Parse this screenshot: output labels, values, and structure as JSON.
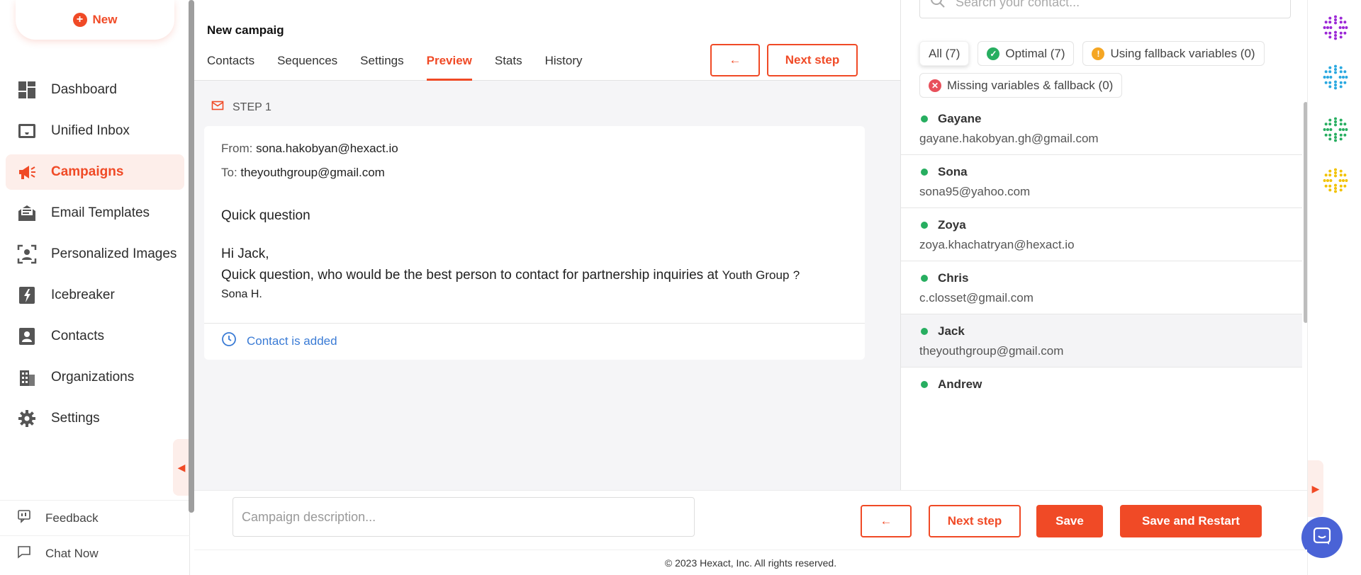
{
  "sidebar": {
    "new_label": "New",
    "items": [
      {
        "label": "Dashboard",
        "icon": "dashboard-icon"
      },
      {
        "label": "Unified Inbox",
        "icon": "inbox-icon"
      },
      {
        "label": "Campaigns",
        "icon": "megaphone-icon",
        "active": true
      },
      {
        "label": "Email Templates",
        "icon": "email-template-icon"
      },
      {
        "label": "Personalized Images",
        "icon": "person-frame-icon"
      },
      {
        "label": "Icebreaker",
        "icon": "lightning-icon"
      },
      {
        "label": "Contacts",
        "icon": "contact-card-icon"
      },
      {
        "label": "Organizations",
        "icon": "building-icon"
      },
      {
        "label": "Settings",
        "icon": "gear-icon"
      }
    ],
    "bottom": [
      {
        "label": "Feedback",
        "icon": "feedback-icon"
      },
      {
        "label": "Chat Now",
        "icon": "chat-icon"
      }
    ]
  },
  "header": {
    "campaign_title": "New campaig",
    "tabs": [
      "Contacts",
      "Sequences",
      "Settings",
      "Preview",
      "Stats",
      "History"
    ],
    "active_tab": "Preview",
    "back_arrow": "←",
    "next_step_label": "Next step"
  },
  "preview": {
    "step_label": "STEP 1",
    "from_label": "From:",
    "from_value": "sona.hakobyan@hexact.io",
    "to_label": "To:",
    "to_value": "theyouthgroup@gmail.com",
    "subject": "Quick question",
    "greeting": "Hi Jack,",
    "body_line": "Quick question, who would be the best person to contact for partnership inquiries at",
    "company": "Youth Group",
    "question_mark": "?",
    "signature": "Sona H.",
    "status": "Contact is added"
  },
  "contacts_panel": {
    "search_placeholder": "Search your contact...",
    "filters": [
      {
        "label": "All (7)",
        "type": "none",
        "active": true
      },
      {
        "label": "Optimal (7)",
        "type": "ok",
        "color": "#27ae60"
      },
      {
        "label": "Using fallback variables (0)",
        "type": "warn",
        "color": "#f5a623"
      },
      {
        "label": "Missing variables & fallback (0)",
        "type": "error",
        "color": "#e8505b"
      }
    ],
    "contacts": [
      {
        "name": "Gayane",
        "email": "gayane.hakobyan.gh@gmail.com"
      },
      {
        "name": "Sona",
        "email": "sona95@yahoo.com"
      },
      {
        "name": "Zoya",
        "email": "zoya.khachatryan@hexact.io"
      },
      {
        "name": "Chris",
        "email": "c.closset@gmail.com"
      },
      {
        "name": "Jack",
        "email": "theyouthgroup@gmail.com",
        "selected": true
      },
      {
        "name": "Andrew",
        "email": ""
      }
    ]
  },
  "bottom_bar": {
    "description_placeholder": "Campaign description...",
    "back_arrow": "←",
    "next_step_label": "Next step",
    "save_label": "Save",
    "save_restart_label": "Save and Restart"
  },
  "footer": {
    "copyright": "© 2023 Hexact, Inc. All rights reserved."
  },
  "rail": {
    "apps": [
      "#9b27d6",
      "#29a8e0",
      "#27ae60",
      "#f2c200"
    ]
  },
  "colors": {
    "accent": "#f04a26",
    "online": "#27ae60",
    "link": "#3a7bd5",
    "chat": "#4a63d6"
  }
}
